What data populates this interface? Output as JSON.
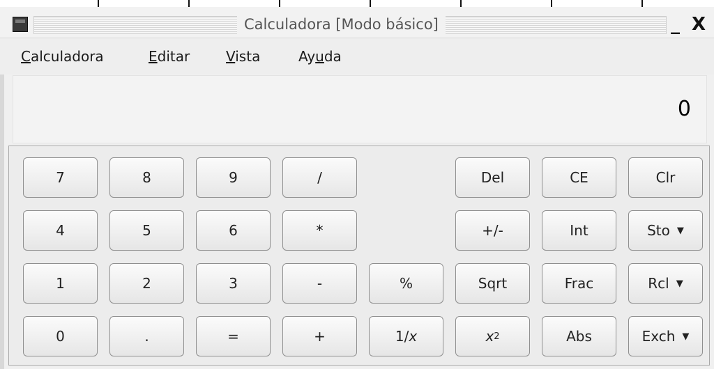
{
  "window": {
    "title": "Calculadora  [Modo básico]",
    "minimize_label": "_",
    "close_label": "X"
  },
  "menu": {
    "items": [
      {
        "accel": "C",
        "rest": "alculadora"
      },
      {
        "accel": "E",
        "rest": "ditar"
      },
      {
        "accel": "V",
        "rest": "ista"
      },
      {
        "pre": "Ay",
        "accel": "u",
        "rest": "da"
      }
    ]
  },
  "display": {
    "value": "0"
  },
  "keys": {
    "k7": "7",
    "k8": "8",
    "k9": "9",
    "div": "/",
    "del": "Del",
    "ce": "CE",
    "clr": "Clr",
    "k4": "4",
    "k5": "5",
    "k6": "6",
    "mul": "*",
    "plusminus": "+/-",
    "int": "Int",
    "sto": "Sto",
    "k1": "1",
    "k2": "2",
    "k3": "3",
    "sub": "-",
    "pct": "%",
    "sqrt": "Sqrt",
    "frac": "Frac",
    "rcl": "Rcl",
    "k0": "0",
    "dot": ".",
    "eq": "=",
    "add": "+",
    "recip_pre": "1/",
    "recip_var": "x",
    "square_base": "x",
    "square_exp": "2",
    "abs": "Abs",
    "exch": "Exch",
    "dropdown_arrow": "▼"
  },
  "colors": {
    "window_bg": "#f0f0f0",
    "button_border": "#8f8f8f"
  }
}
